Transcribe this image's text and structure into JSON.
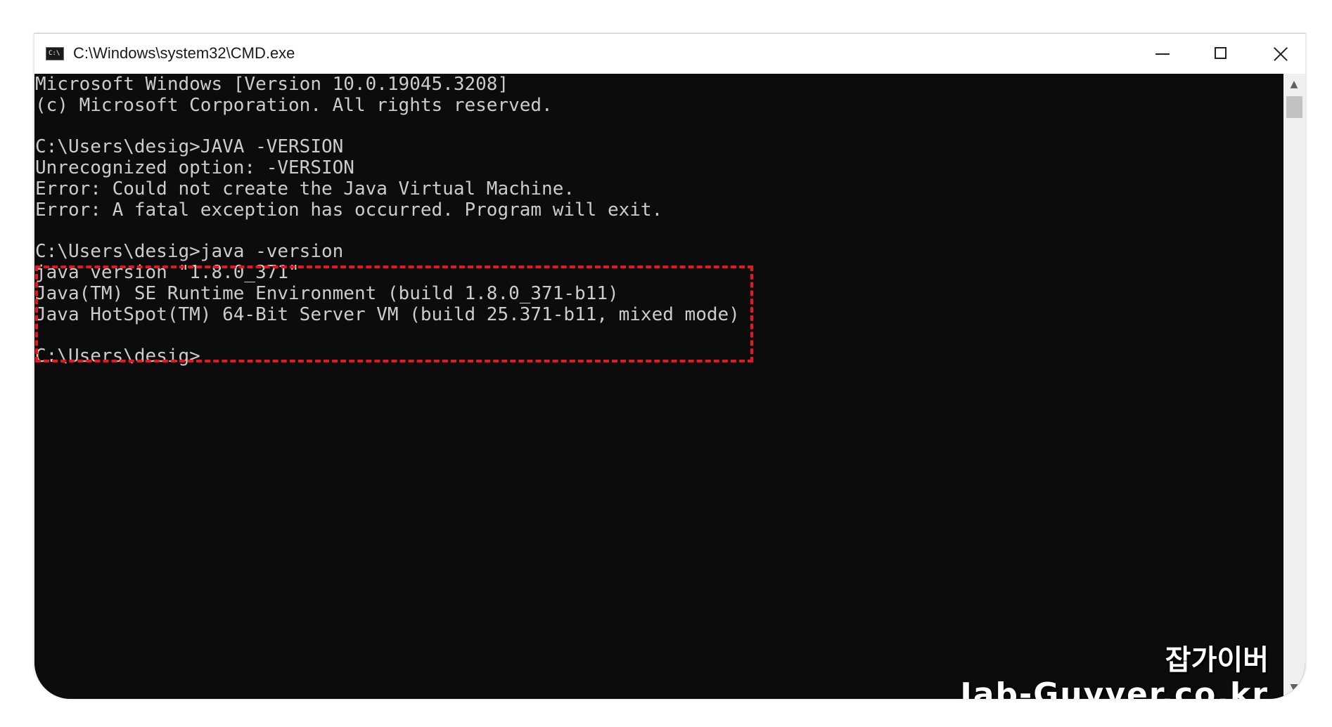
{
  "window": {
    "title": "C:\\Windows\\system32\\CMD.exe",
    "icon_label": "C:\\",
    "controls": {
      "minimize": "minimize-icon",
      "maximize": "maximize-icon",
      "close": "close-icon"
    }
  },
  "console": {
    "lines": [
      "Microsoft Windows [Version 10.0.19045.3208]",
      "(c) Microsoft Corporation. All rights reserved.",
      "",
      "C:\\Users\\desig>JAVA -VERSION",
      "Unrecognized option: -VERSION",
      "Error: Could not create the Java Virtual Machine.",
      "Error: A fatal exception has occurred. Program will exit.",
      "",
      "C:\\Users\\desig>java -version",
      "java version \"1.8.0_371\"",
      "Java(TM) SE Runtime Environment (build 1.8.0_371-b11)",
      "Java HotSpot(TM) 64-Bit Server VM (build 25.371-b11, mixed mode)",
      "",
      "C:\\Users\\desig>"
    ],
    "text_color": "#cccccc",
    "background_color": "#0c0c0c"
  },
  "highlight": {
    "color": "#e8161e"
  },
  "scrollbar": {
    "up_glyph": "▲",
    "down_glyph": "▼"
  },
  "watermark": {
    "korean": "잡가이버",
    "domain": "Jab-Guyver.co.kr"
  }
}
